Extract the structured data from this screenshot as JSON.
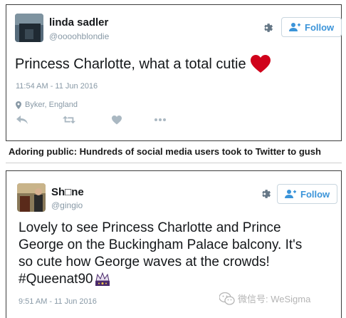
{
  "tweet1": {
    "name": "linda sadler",
    "handle": "@oooohblondie",
    "follow_label": "Follow",
    "text": "Princess Charlotte, what a total cutie",
    "timestamp": "11:54 AM - 11 Jun 2016",
    "location": "Byker, England",
    "heart_color": "#d0021b"
  },
  "caption": "Adoring public: Hundreds of social media users took to Twitter to gush",
  "tweet2": {
    "name": "Sh□ne",
    "handle": "@gingio",
    "follow_label": "Follow",
    "text_lines": [
      "Lovely to see Princess Charlotte and Prince",
      "George on the Buckingham Palace balcony. It's",
      "so cute how George waves at the crowds!",
      "#Queenat90"
    ],
    "timestamp": "9:51 AM - 11 Jun 2016"
  },
  "watermark": "微信号: WeSigma",
  "colors": {
    "link_blue": "#3b94d9",
    "muted_gray": "#8899a6",
    "border": "#3d3d3d"
  }
}
